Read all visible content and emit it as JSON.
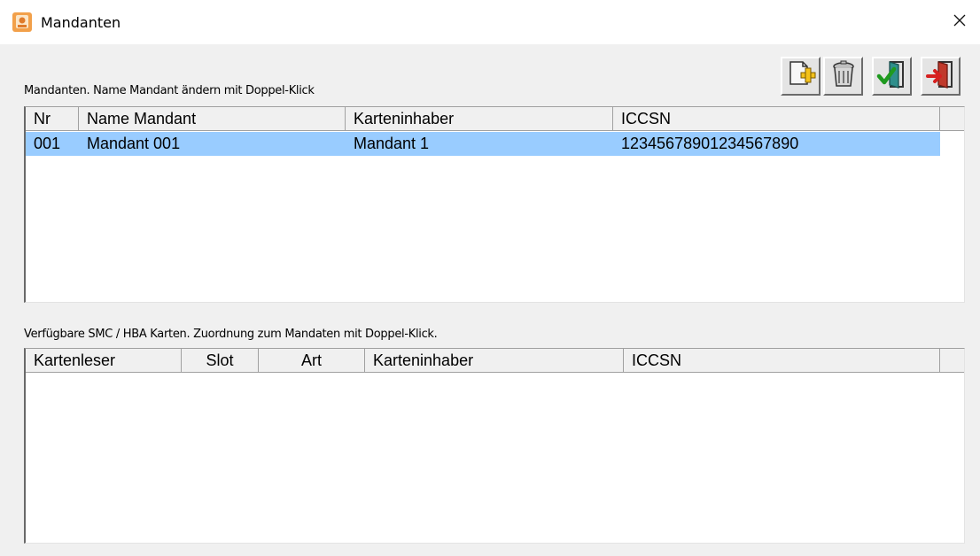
{
  "window": {
    "title": "Mandanten"
  },
  "toolbar": {
    "buttons": [
      {
        "icon": "add-document-icon"
      },
      {
        "icon": "trash-icon"
      },
      {
        "icon": "accept-exit-icon"
      },
      {
        "icon": "cancel-exit-icon"
      }
    ]
  },
  "mandanten": {
    "label": "Mandanten. Name Mandant ändern mit Doppel-Klick",
    "columns": [
      "Nr",
      "Name Mandant",
      "Karteninhaber",
      "ICCSN"
    ],
    "rows": [
      {
        "nr": "001",
        "name": "Mandant 001",
        "inhaber": "Mandant 1",
        "iccsn": "12345678901234567890",
        "selected": true
      }
    ]
  },
  "karten": {
    "label": "Verfügbare SMC / HBA Karten. Zuordnung zum Mandaten mit Doppel-Klick.",
    "columns": [
      "Kartenleser",
      "Slot",
      "Art",
      "Karteninhaber",
      "ICCSN"
    ],
    "rows": []
  },
  "colors": {
    "selection": "#99ccff",
    "background": "#f0f0f0"
  }
}
